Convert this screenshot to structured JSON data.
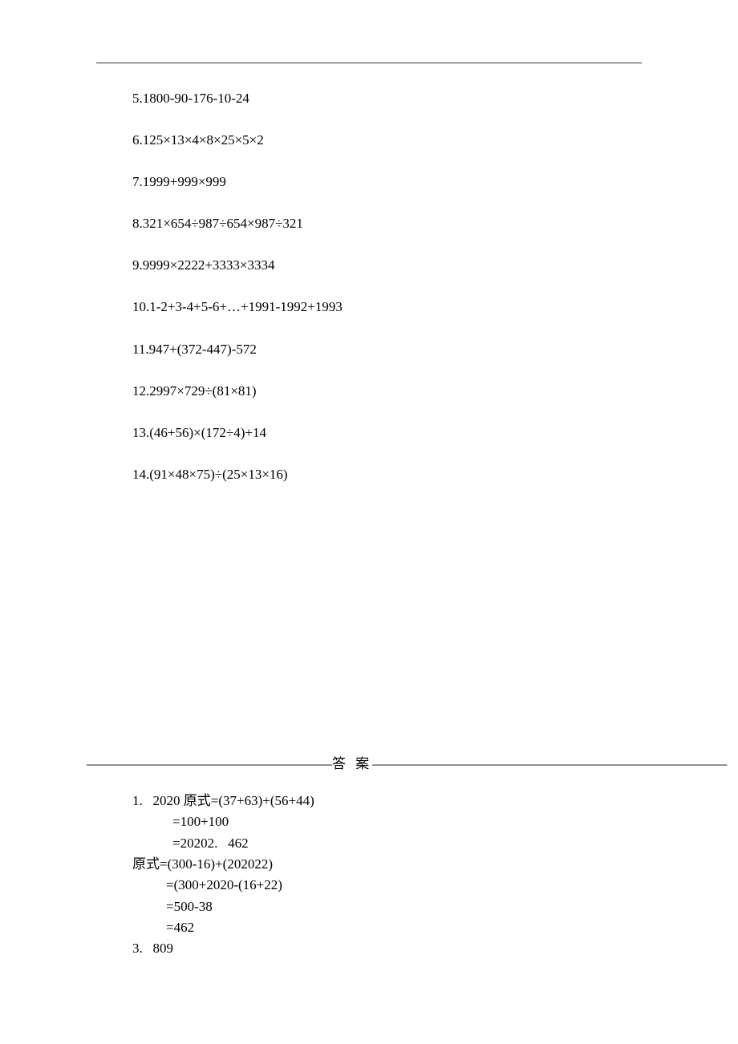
{
  "problems": {
    "p5": "5.1800-90-176-10-24",
    "p6": "6.125×13×4×8×25×5×2",
    "p7": "7.1999+999×999",
    "p8": "8.321×654÷987÷654×987÷321",
    "p9": "9.9999×2222+3333×3334",
    "p10": "10.1-2+3-4+5-6+…+1991-1992+1993",
    "p11": "11.947+(372-447)-572",
    "p12": "12.2997×729÷(81×81)",
    "p13": "13.(46+56)×(172÷4)+14",
    "p14": "14.(91×48×75)÷(25×13×16)"
  },
  "divider": {
    "left": "——————————————————",
    "label": "答 案",
    "right": "——————————————————————————"
  },
  "answers": {
    "a1_head": "1.   2020 原式=(37+63)+(56+44)",
    "a1_l2": "=100+100",
    "a1_l3": "=20202.   462",
    "a2_head": "原式=(300-16)+(202022)",
    "a2_l2": "=(300+2020-(16+22)",
    "a2_l3": "=500-38",
    "a2_l4": "=462",
    "a3_head": "3.   809"
  }
}
